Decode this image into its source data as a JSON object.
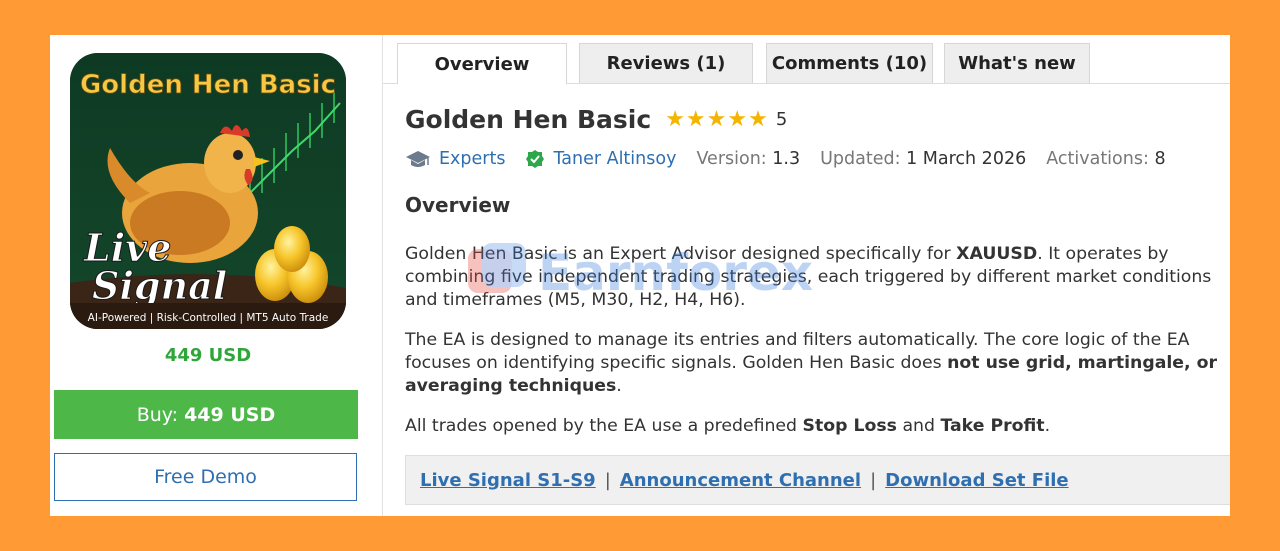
{
  "product": {
    "image_title": "Golden Hen Basic",
    "image_line1": "Live",
    "image_line2": "Signal",
    "image_footer": "AI-Powered | Risk-Controlled | MT5 Auto Trade",
    "price": "449 USD",
    "buy_prefix": "Buy:",
    "buy_price": "449 USD",
    "demo_label": "Free Demo"
  },
  "tabs": [
    {
      "label": "Overview",
      "active": true
    },
    {
      "label": "Reviews (1)",
      "active": false
    },
    {
      "label": "Comments (10)",
      "active": false
    },
    {
      "label": "What's new",
      "active": false
    }
  ],
  "header": {
    "title": "Golden Hen Basic",
    "stars": "★★★★★",
    "rating": "5"
  },
  "meta": {
    "category": "Experts",
    "category_icon": "graduation-cap-icon",
    "author": "Taner Altinsoy",
    "author_icon": "verified-badge-icon",
    "version_label": "Version:",
    "version": "1.3",
    "updated_label": "Updated:",
    "updated": "1 March 2026",
    "activations_label": "Activations:",
    "activations": "8"
  },
  "overview": {
    "heading": "Overview",
    "p1_a": "Golden Hen Basic is an Expert Advisor designed specifically for ",
    "p1_b": "XAUUSD",
    "p1_c": ". It operates by combining five independent trading strategies, each triggered by different market conditions and timeframes (M5, M30, H2, H4, H6).",
    "p2_a": "The EA is designed to manage its entries and filters automatically. The core logic of the EA focuses on identifying specific signals. Golden Hen Basic does ",
    "p2_b": "not use grid, martingale, or averaging techniques",
    "p2_c": ".",
    "p3_a": "All trades opened by the EA use a predefined ",
    "p3_b": "Stop Loss",
    "p3_c": " and ",
    "p3_d": "Take Profit",
    "p3_e": "."
  },
  "links": {
    "live_signal": "Live Signal S1-S9",
    "separator": "|",
    "announcement": "Announcement Channel",
    "set_file": "Download Set File"
  },
  "watermark": {
    "text": "Earnforex"
  },
  "colors": {
    "frame": "#ff9a35",
    "price_green": "#2ea63a",
    "buy_green": "#4db848",
    "link_blue": "#2f6fb0",
    "star_gold": "#f4b400"
  }
}
